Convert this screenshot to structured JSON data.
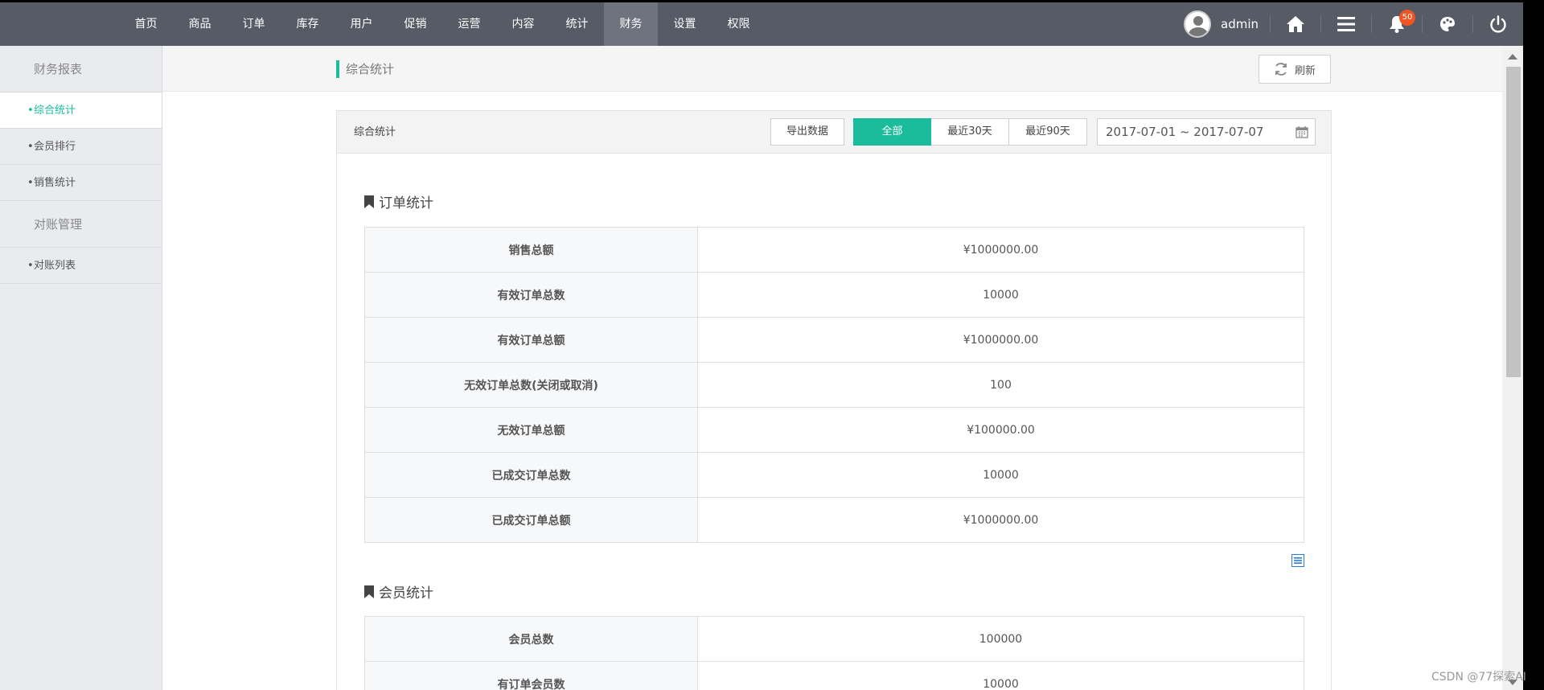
{
  "nav": {
    "items": [
      {
        "label": "首页"
      },
      {
        "label": "商品"
      },
      {
        "label": "订单"
      },
      {
        "label": "库存"
      },
      {
        "label": "用户"
      },
      {
        "label": "促销"
      },
      {
        "label": "运营"
      },
      {
        "label": "内容"
      },
      {
        "label": "统计"
      },
      {
        "label": "财务"
      },
      {
        "label": "设置"
      },
      {
        "label": "权限"
      }
    ],
    "active": "财务"
  },
  "user": {
    "name": "admin"
  },
  "notifications": {
    "count": "50"
  },
  "sidebar": {
    "group1": "财务报表",
    "group1_items": [
      {
        "label": "综合统计",
        "active": true
      },
      {
        "label": "会员排行"
      },
      {
        "label": "销售统计"
      }
    ],
    "group2": "对账管理",
    "group2_items": [
      {
        "label": "对账列表"
      }
    ]
  },
  "breadcrumb": "综合统计",
  "refresh_label": "刷新",
  "panel": {
    "title": "综合统计",
    "export_label": "导出数据",
    "ranges": [
      "全部",
      "最近30天",
      "最近90天"
    ],
    "active_range": "全部",
    "date_range": "2017-07-01 ~ 2017-07-07"
  },
  "order_stats": {
    "title": "订单统计",
    "rows": [
      {
        "label": "销售总额",
        "value": "¥1000000.00"
      },
      {
        "label": "有效订单总数",
        "value": "10000"
      },
      {
        "label": "有效订单总额",
        "value": "¥1000000.00"
      },
      {
        "label": "无效订单总数(关闭或取消)",
        "value": "100"
      },
      {
        "label": "无效订单总额",
        "value": "¥100000.00"
      },
      {
        "label": "已成交订单总数",
        "value": "10000"
      },
      {
        "label": "已成交订单总额",
        "value": "¥1000000.00"
      }
    ]
  },
  "member_stats": {
    "title": "会员统计",
    "rows": [
      {
        "label": "会员总数",
        "value": "100000"
      },
      {
        "label": "有订单会员数",
        "value": "10000"
      }
    ]
  },
  "watermark": "CSDN @77探索AI",
  "colors": {
    "accent": "#1abc9c",
    "topbar": "#565b66",
    "badge": "#f05423"
  }
}
